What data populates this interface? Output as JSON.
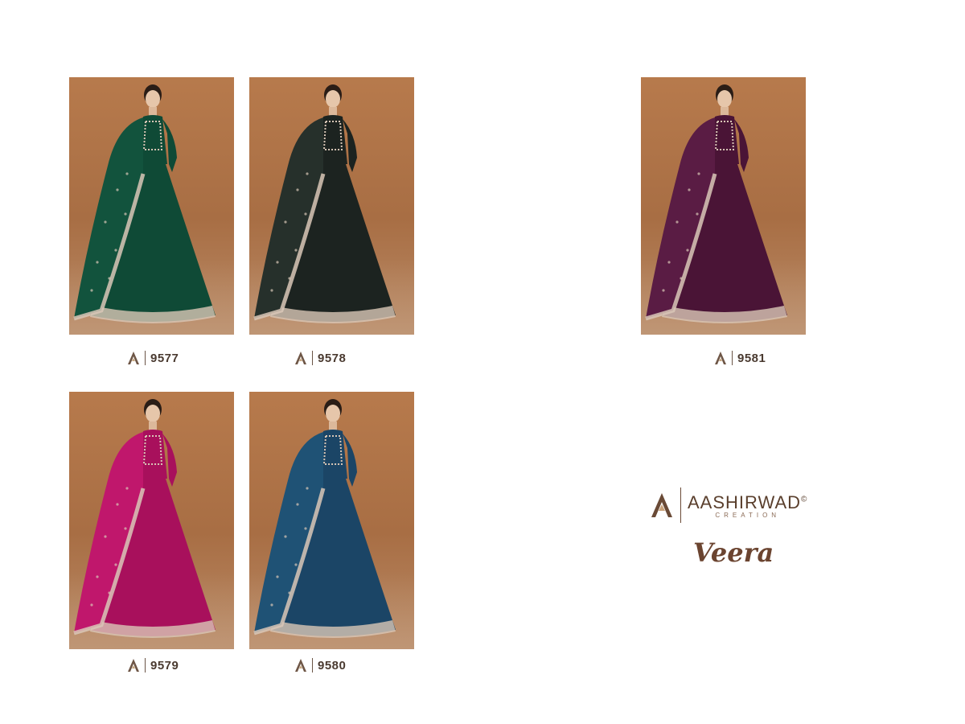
{
  "products": [
    {
      "code": "9577",
      "color": "#0f4a36",
      "dupatta": "#12533d"
    },
    {
      "code": "9578",
      "color": "#1c2320",
      "dupatta": "#26302b"
    },
    {
      "code": "9581",
      "color": "#4a1436",
      "dupatta": "#5a1c44"
    },
    {
      "code": "9579",
      "color": "#a8105c",
      "dupatta": "#c0176c"
    },
    {
      "code": "9580",
      "color": "#1b4566",
      "dupatta": "#1f5275"
    }
  ],
  "brand": {
    "name": "AASHIRWAD",
    "registered": "©",
    "subtitle": "CREATION",
    "collection": "Veera"
  },
  "colors": {
    "backdrop": "#b07448",
    "trim": "#d9c7b7",
    "text": "#4a3a30"
  }
}
